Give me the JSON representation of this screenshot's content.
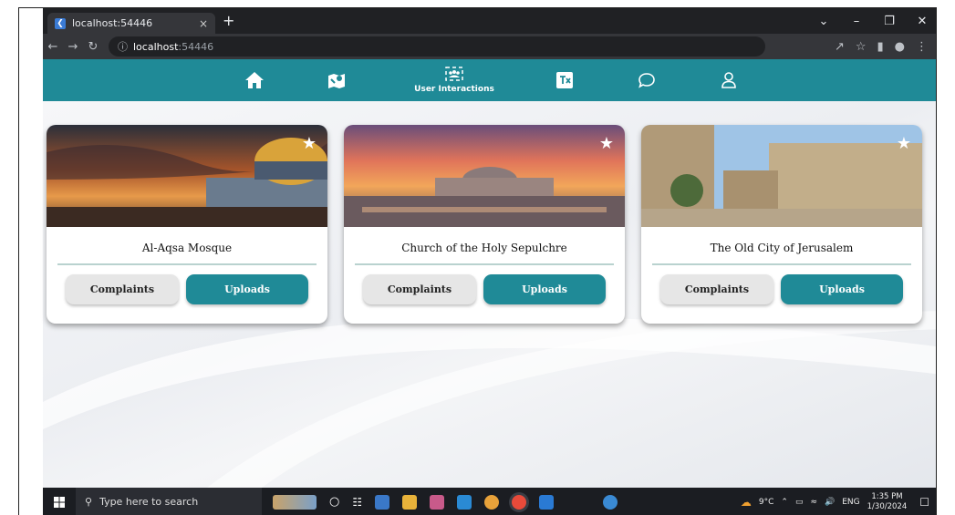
{
  "browser": {
    "tab_title": "localhost:54446",
    "tab_close": "×",
    "new_tab": "+",
    "url_host": "localhost",
    "url_port": ":54446",
    "window_controls": [
      "⌄",
      "–",
      "❐",
      "✕"
    ]
  },
  "nav": {
    "items": [
      {
        "icon": "home-icon",
        "label": ""
      },
      {
        "icon": "map-icon",
        "label": ""
      },
      {
        "icon": "user-interactions-icon",
        "label": "User Interactions"
      },
      {
        "icon": "translate-icon",
        "label": ""
      },
      {
        "icon": "chat-icon",
        "label": ""
      },
      {
        "icon": "profile-icon",
        "label": ""
      }
    ],
    "color": "#1f8a97"
  },
  "cards": [
    {
      "title": "Al-Aqsa Mosque",
      "complaints_label": "Complaints",
      "uploads_label": "Uploads"
    },
    {
      "title": "Church of the Holy Sepulchre",
      "complaints_label": "Complaints",
      "uploads_label": "Uploads"
    },
    {
      "title": "The Old City of Jerusalem",
      "complaints_label": "Complaints",
      "uploads_label": "Uploads"
    }
  ],
  "taskbar": {
    "search_placeholder": "Type here to search",
    "weather": "9°C",
    "language": "ENG",
    "time": "1:35 PM",
    "date": "1/30/2024"
  }
}
